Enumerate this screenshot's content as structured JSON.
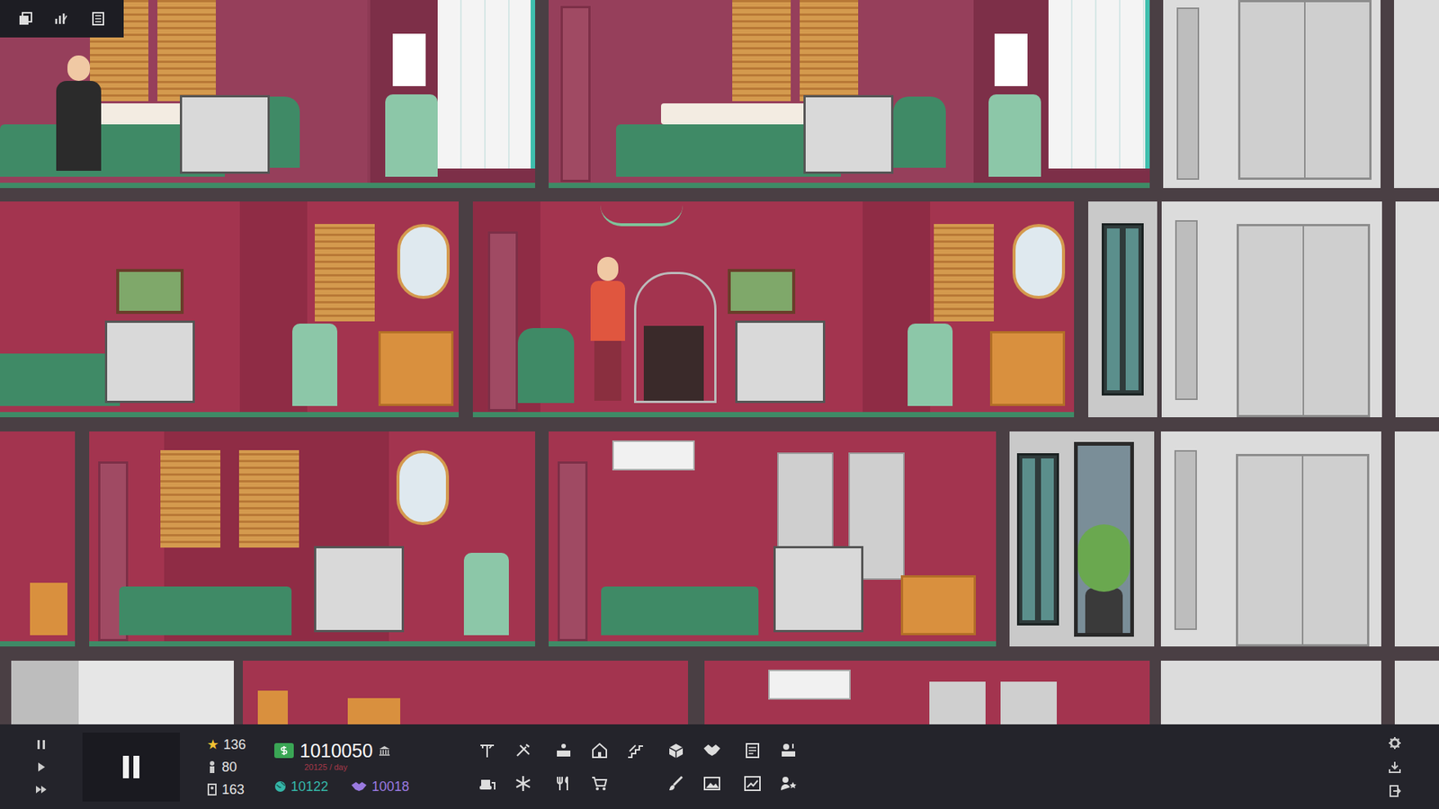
{
  "stats": {
    "rating": "136",
    "staff": "80",
    "guests": "163"
  },
  "money": {
    "amount": "1010050",
    "rate": "20125 / day"
  },
  "currencies": [
    {
      "value": "10122",
      "color": "#35b7a8"
    },
    {
      "value": "10018",
      "color": "#9a7ae0"
    }
  ]
}
